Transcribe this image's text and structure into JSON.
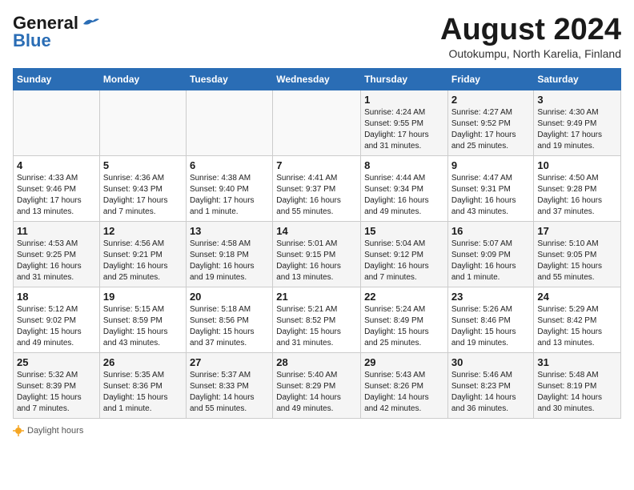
{
  "header": {
    "logo_line1": "General",
    "logo_line2": "Blue",
    "month_title": "August 2024",
    "subtitle": "Outokumpu, North Karelia, Finland"
  },
  "days_of_week": [
    "Sunday",
    "Monday",
    "Tuesday",
    "Wednesday",
    "Thursday",
    "Friday",
    "Saturday"
  ],
  "weeks": [
    [
      {
        "day": "",
        "info": ""
      },
      {
        "day": "",
        "info": ""
      },
      {
        "day": "",
        "info": ""
      },
      {
        "day": "",
        "info": ""
      },
      {
        "day": "1",
        "info": "Sunrise: 4:24 AM\nSunset: 9:55 PM\nDaylight: 17 hours\nand 31 minutes."
      },
      {
        "day": "2",
        "info": "Sunrise: 4:27 AM\nSunset: 9:52 PM\nDaylight: 17 hours\nand 25 minutes."
      },
      {
        "day": "3",
        "info": "Sunrise: 4:30 AM\nSunset: 9:49 PM\nDaylight: 17 hours\nand 19 minutes."
      }
    ],
    [
      {
        "day": "4",
        "info": "Sunrise: 4:33 AM\nSunset: 9:46 PM\nDaylight: 17 hours\nand 13 minutes."
      },
      {
        "day": "5",
        "info": "Sunrise: 4:36 AM\nSunset: 9:43 PM\nDaylight: 17 hours\nand 7 minutes."
      },
      {
        "day": "6",
        "info": "Sunrise: 4:38 AM\nSunset: 9:40 PM\nDaylight: 17 hours\nand 1 minute."
      },
      {
        "day": "7",
        "info": "Sunrise: 4:41 AM\nSunset: 9:37 PM\nDaylight: 16 hours\nand 55 minutes."
      },
      {
        "day": "8",
        "info": "Sunrise: 4:44 AM\nSunset: 9:34 PM\nDaylight: 16 hours\nand 49 minutes."
      },
      {
        "day": "9",
        "info": "Sunrise: 4:47 AM\nSunset: 9:31 PM\nDaylight: 16 hours\nand 43 minutes."
      },
      {
        "day": "10",
        "info": "Sunrise: 4:50 AM\nSunset: 9:28 PM\nDaylight: 16 hours\nand 37 minutes."
      }
    ],
    [
      {
        "day": "11",
        "info": "Sunrise: 4:53 AM\nSunset: 9:25 PM\nDaylight: 16 hours\nand 31 minutes."
      },
      {
        "day": "12",
        "info": "Sunrise: 4:56 AM\nSunset: 9:21 PM\nDaylight: 16 hours\nand 25 minutes."
      },
      {
        "day": "13",
        "info": "Sunrise: 4:58 AM\nSunset: 9:18 PM\nDaylight: 16 hours\nand 19 minutes."
      },
      {
        "day": "14",
        "info": "Sunrise: 5:01 AM\nSunset: 9:15 PM\nDaylight: 16 hours\nand 13 minutes."
      },
      {
        "day": "15",
        "info": "Sunrise: 5:04 AM\nSunset: 9:12 PM\nDaylight: 16 hours\nand 7 minutes."
      },
      {
        "day": "16",
        "info": "Sunrise: 5:07 AM\nSunset: 9:09 PM\nDaylight: 16 hours\nand 1 minute."
      },
      {
        "day": "17",
        "info": "Sunrise: 5:10 AM\nSunset: 9:05 PM\nDaylight: 15 hours\nand 55 minutes."
      }
    ],
    [
      {
        "day": "18",
        "info": "Sunrise: 5:12 AM\nSunset: 9:02 PM\nDaylight: 15 hours\nand 49 minutes."
      },
      {
        "day": "19",
        "info": "Sunrise: 5:15 AM\nSunset: 8:59 PM\nDaylight: 15 hours\nand 43 minutes."
      },
      {
        "day": "20",
        "info": "Sunrise: 5:18 AM\nSunset: 8:56 PM\nDaylight: 15 hours\nand 37 minutes."
      },
      {
        "day": "21",
        "info": "Sunrise: 5:21 AM\nSunset: 8:52 PM\nDaylight: 15 hours\nand 31 minutes."
      },
      {
        "day": "22",
        "info": "Sunrise: 5:24 AM\nSunset: 8:49 PM\nDaylight: 15 hours\nand 25 minutes."
      },
      {
        "day": "23",
        "info": "Sunrise: 5:26 AM\nSunset: 8:46 PM\nDaylight: 15 hours\nand 19 minutes."
      },
      {
        "day": "24",
        "info": "Sunrise: 5:29 AM\nSunset: 8:42 PM\nDaylight: 15 hours\nand 13 minutes."
      }
    ],
    [
      {
        "day": "25",
        "info": "Sunrise: 5:32 AM\nSunset: 8:39 PM\nDaylight: 15 hours\nand 7 minutes."
      },
      {
        "day": "26",
        "info": "Sunrise: 5:35 AM\nSunset: 8:36 PM\nDaylight: 15 hours\nand 1 minute."
      },
      {
        "day": "27",
        "info": "Sunrise: 5:37 AM\nSunset: 8:33 PM\nDaylight: 14 hours\nand 55 minutes."
      },
      {
        "day": "28",
        "info": "Sunrise: 5:40 AM\nSunset: 8:29 PM\nDaylight: 14 hours\nand 49 minutes."
      },
      {
        "day": "29",
        "info": "Sunrise: 5:43 AM\nSunset: 8:26 PM\nDaylight: 14 hours\nand 42 minutes."
      },
      {
        "day": "30",
        "info": "Sunrise: 5:46 AM\nSunset: 8:23 PM\nDaylight: 14 hours\nand 36 minutes."
      },
      {
        "day": "31",
        "info": "Sunrise: 5:48 AM\nSunset: 8:19 PM\nDaylight: 14 hours\nand 30 minutes."
      }
    ]
  ],
  "footer": {
    "daylight_label": "Daylight hours"
  }
}
